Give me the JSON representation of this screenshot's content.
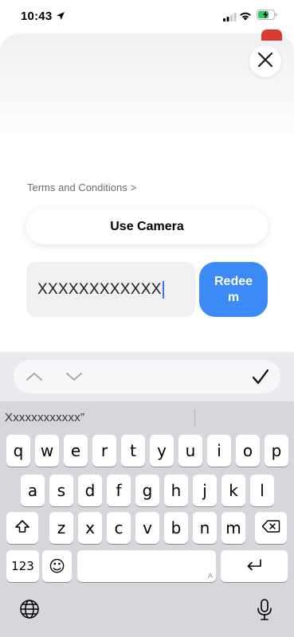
{
  "status_bar": {
    "time": "10:43",
    "icons": [
      "location-arrow-icon",
      "cellular-signal-icon",
      "wifi-icon",
      "battery-charging-icon"
    ]
  },
  "sheet": {
    "close_icon": "close-icon",
    "terms_label": "Terms and Conditions",
    "terms_chevron": ">",
    "use_camera_label": "Use Camera",
    "code_field_value": "XXXXXXXXXXXX",
    "redeem_label": "Redeem"
  },
  "accessory_bar": {
    "icons": [
      "chevron-up-icon",
      "chevron-down-icon",
      "checkmark-icon"
    ]
  },
  "suggestions": {
    "first": "Xxxxxxxxxxxx”"
  },
  "keyboard": {
    "row1": [
      "q",
      "w",
      "e",
      "r",
      "t",
      "y",
      "u",
      "i",
      "o",
      "p"
    ],
    "row2": [
      "a",
      "s",
      "d",
      "f",
      "g",
      "h",
      "j",
      "k",
      "l"
    ],
    "row3": [
      "z",
      "x",
      "c",
      "v",
      "b",
      "n",
      "m"
    ],
    "numbers_key": "123",
    "emoji_key": "☺",
    "space_hint": "A",
    "icons": [
      "shift-icon",
      "delete-icon",
      "return-icon",
      "globe-icon",
      "microphone-icon"
    ]
  },
  "colors": {
    "accent": "#3b8af5",
    "caret": "#3478f6",
    "keyboard_bg": "#d5d7dd",
    "function_key": "#abafb8"
  }
}
